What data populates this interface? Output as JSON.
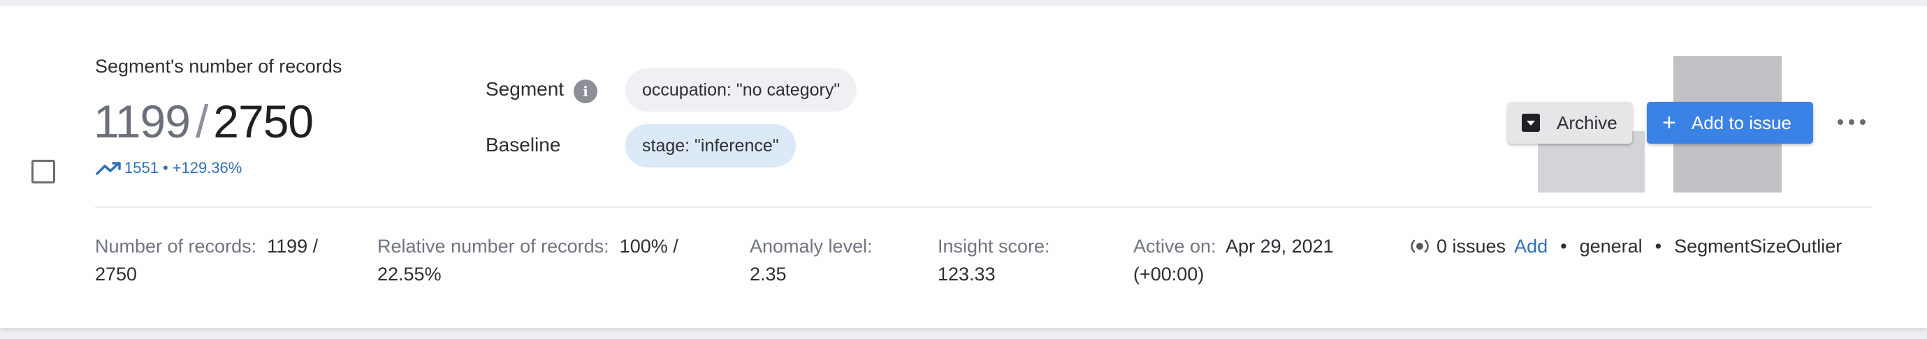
{
  "metric": {
    "title": "Segment's number of records",
    "value": "1199",
    "separator": "/",
    "total": "2750",
    "trend_value": "1551",
    "trend_separator": "•",
    "trend_percent": "+129.36%"
  },
  "segment": {
    "label": "Segment",
    "chip": "occupation: \"no category\""
  },
  "baseline": {
    "label": "Baseline",
    "chip": "stage: \"inference\""
  },
  "mini_chart": {
    "values": [
      0.45,
      1.0
    ]
  },
  "actions": {
    "archive_label": "Archive",
    "add_label": "Add to issue"
  },
  "stats": [
    {
      "label": "Number of records:",
      "value": "1199 / 2750"
    },
    {
      "label": "Relative number of records:",
      "value": "100% / 22.55%"
    },
    {
      "label": "Anomaly level:",
      "value": "2.35"
    },
    {
      "label": "Insight score:",
      "value": "123.33"
    },
    {
      "label": "Active on:",
      "value": "Apr 29, 2021 (+00:00)"
    }
  ],
  "meta": {
    "issues": "0 issues",
    "add_link": "Add",
    "bullet": "•",
    "category": "general",
    "type": "SegmentSizeOutlier"
  },
  "colors": {
    "accent": "#3b82e6",
    "link": "#2f6fb7",
    "baseline_chip": "#dce9f7",
    "segment_chip": "#eef0f4"
  }
}
